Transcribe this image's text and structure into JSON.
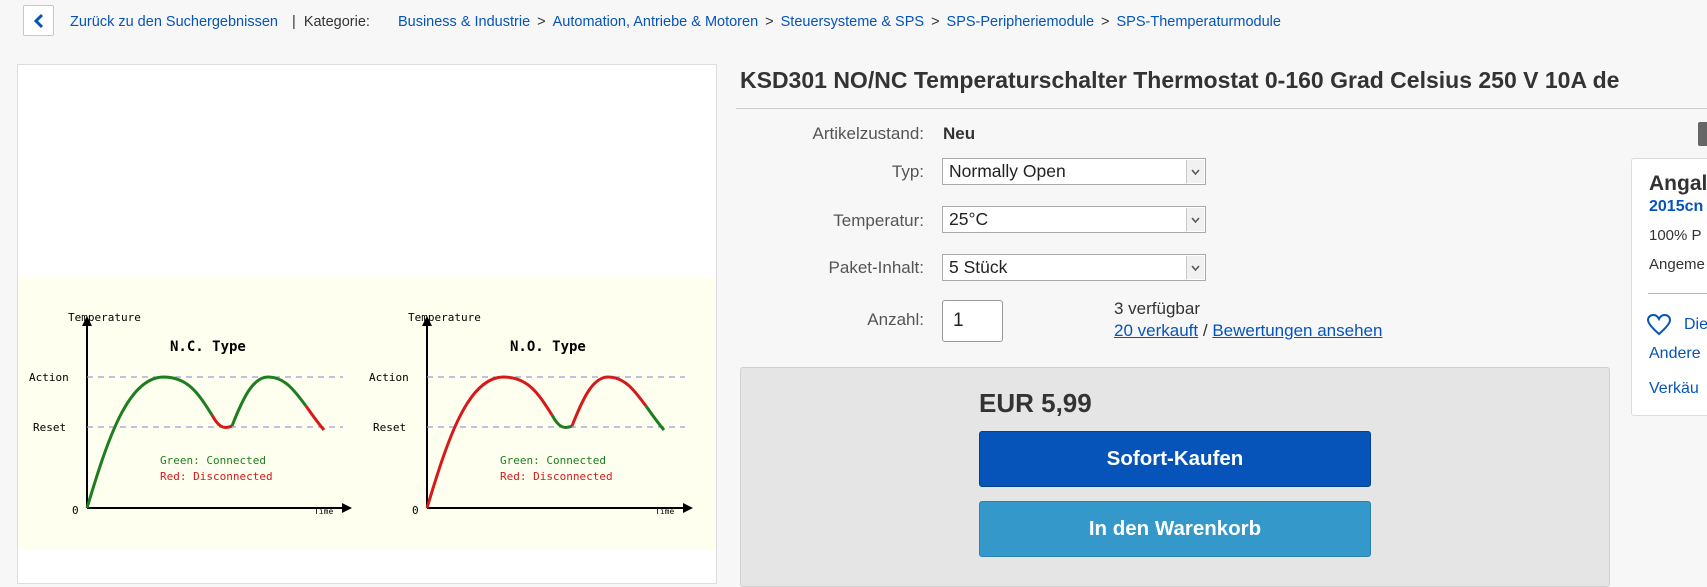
{
  "breadcrumb": {
    "back_label": "Zurück zu den Suchergebnissen",
    "category_label": "Kategorie:",
    "items": [
      "Business & Industrie",
      "Automation, Antriebe & Motoren",
      "Steuersysteme & SPS",
      "SPS-Peripheriemodule",
      "SPS-Themperaturmodule"
    ],
    "separator": ">",
    "divider": "|"
  },
  "product": {
    "title": "KSD301 NO/NC Temperaturschalter Thermostat 0-160 Grad Celsius 250 V 10A de"
  },
  "diagram": {
    "left": {
      "y_axis": "Temperature",
      "type": "N.C.  Type",
      "action": "Action",
      "reset": "Reset",
      "green": "Green: Connected",
      "red": "Red: Disconnected",
      "origin": "0",
      "x_axis": "Time"
    },
    "right": {
      "y_axis": "Temperature",
      "type": "N.O.  Type",
      "action": "Action",
      "reset": "Reset",
      "green": "Green: Connected",
      "red": "Red: Disconnected",
      "origin": "0",
      "x_axis": "Time"
    }
  },
  "details": {
    "condition_label": "Artikelzustand:",
    "condition_value": "Neu",
    "typ_label": "Typ:",
    "typ_value": "Normally Open",
    "temp_label": "Temperatur:",
    "temp_value": "25°C",
    "pack_label": "Paket-Inhalt:",
    "pack_value": "5 Stück",
    "qty_label": "Anzahl:",
    "qty_value": "1",
    "available": "3 verfügbar",
    "sold": "20 verkauft",
    "slash": "/",
    "reviews": "Bewertungen ansehen"
  },
  "buy": {
    "price": "EUR 5,99",
    "buy_now": "Sofort-Kaufen",
    "add_to_cart": "In den Warenkorb"
  },
  "seller": {
    "heading": "Angal",
    "name": "2015cn",
    "positive": "100% P",
    "member": "Angeme",
    "save": "Die",
    "other": "Andere",
    "contact": "Verkäu"
  },
  "colors": {
    "link": "#0654ba",
    "buy_now": "#0654ba",
    "add_to_cart": "#3498ca",
    "curve_connected": "#1e7d1e",
    "curve_disconnected": "#d41a1a"
  }
}
